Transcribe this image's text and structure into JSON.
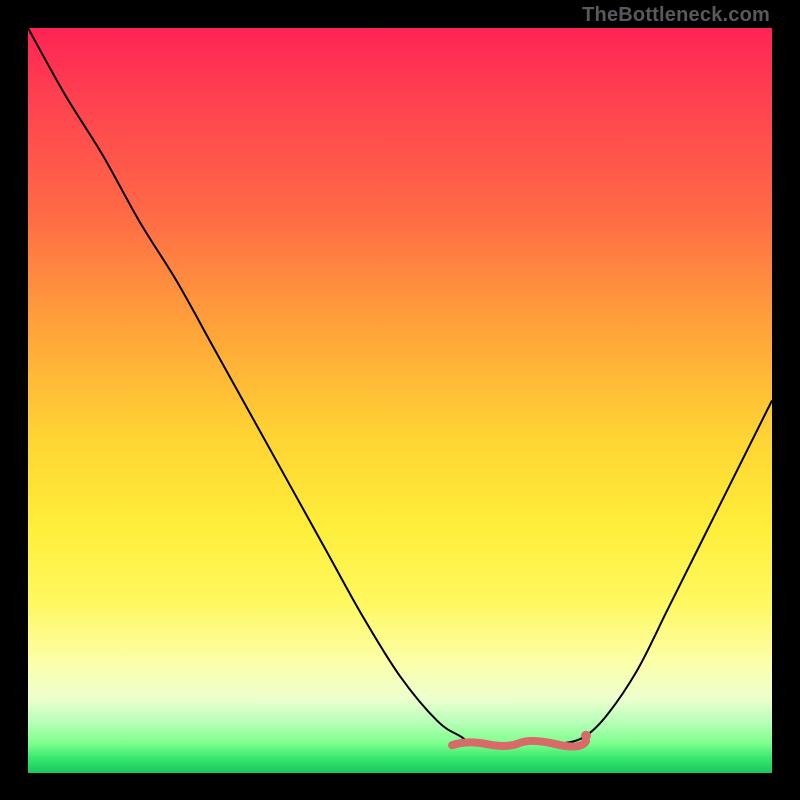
{
  "watermark": "TheBottleneck.com",
  "colors": {
    "frame": "#000000",
    "curve": "#000000",
    "highlight": "#d86a6a"
  },
  "chart_data": {
    "type": "line",
    "title": "",
    "xlabel": "",
    "ylabel": "",
    "xlim": [
      0,
      100
    ],
    "ylim": [
      0,
      100
    ],
    "grid": false,
    "legend": false,
    "note": "x/y in percent of inner plot area; y measured from top (0=top, 100=bottom). V-shaped bottleneck curve with flat trough.",
    "series": [
      {
        "name": "bottleneck-curve",
        "x": [
          0,
          5,
          10,
          15,
          20,
          25,
          30,
          35,
          40,
          45,
          50,
          55,
          58,
          60,
          64,
          68,
          72,
          75,
          78,
          82,
          86,
          90,
          94,
          98,
          100
        ],
        "y": [
          0,
          9,
          17,
          26,
          34,
          43,
          52,
          61,
          70,
          79,
          87,
          93,
          95,
          96,
          96,
          96,
          96,
          95,
          92,
          86,
          78,
          70,
          62,
          54,
          50
        ]
      }
    ],
    "trough": {
      "x_start": 57,
      "x_end": 75,
      "y": 96,
      "end_dot": {
        "x": 75,
        "y": 95
      }
    }
  }
}
